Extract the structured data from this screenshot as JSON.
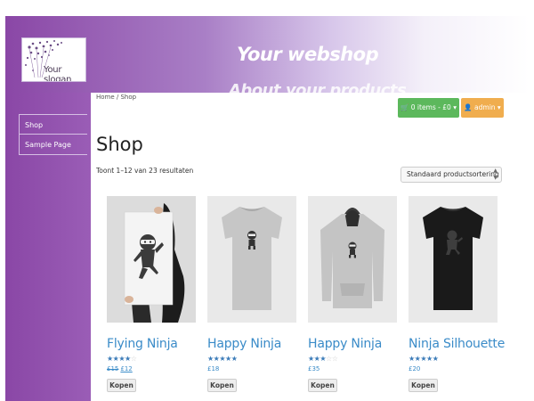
{
  "header": {
    "logo_slogan": "Your slogan",
    "site_title": "Your webshop",
    "site_subtitle": "About your products"
  },
  "sidebar": {
    "items": [
      {
        "label": "Shop"
      },
      {
        "label": "Sample Page"
      }
    ]
  },
  "breadcrumb": "Home / Shop",
  "toolbar": {
    "cart_label": "0 items - £0",
    "admin_label": "admin",
    "cart_color": "#5cb85c",
    "admin_color": "#f0ad4e"
  },
  "page_title": "Shop",
  "result_count": "Toont 1–12 van 23 resultaten",
  "sort": {
    "selected": "Standaard productsortering"
  },
  "products": [
    {
      "name": "Flying Ninja",
      "rating": 4,
      "price_old": "£15",
      "price": "£12",
      "button": "Kopen",
      "image": "poster"
    },
    {
      "name": "Happy Ninja",
      "rating": 5,
      "price_old": "",
      "price": "£18",
      "button": "Kopen",
      "image": "grey-tshirt"
    },
    {
      "name": "Happy Ninja",
      "rating": 3,
      "price_old": "",
      "price": "£35",
      "button": "Kopen",
      "image": "grey-hoodie"
    },
    {
      "name": "Ninja Silhouette",
      "rating": 5,
      "price_old": "",
      "price": "£20",
      "button": "Kopen",
      "image": "black-tshirt"
    }
  ]
}
